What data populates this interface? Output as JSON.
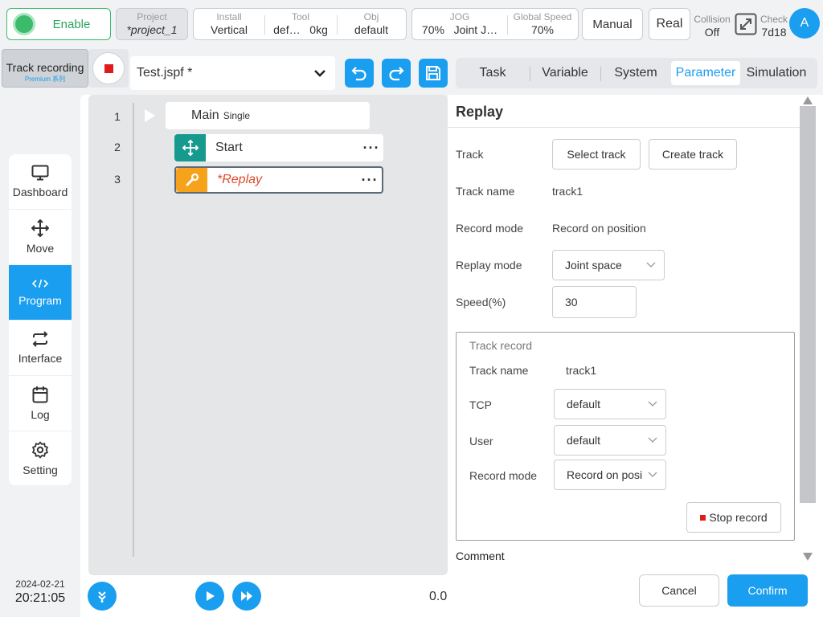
{
  "topbar": {
    "enable_label": "Enable",
    "project": {
      "label": "Project",
      "value": "*project_1"
    },
    "install": {
      "label": "Install",
      "value": "Vertical"
    },
    "tool": {
      "label": "Tool",
      "value_name": "def…",
      "value_weight": "0kg"
    },
    "obj": {
      "label": "Obj",
      "value": "default"
    },
    "jog": {
      "label": "JOG",
      "value_pct": "70%",
      "value_mode": "Joint J…"
    },
    "global_speed": {
      "label": "Global Speed",
      "value": "70%"
    },
    "mode_label": "Manual",
    "real_label": "Real",
    "collision": {
      "label": "Collision",
      "value": "Off"
    },
    "check": {
      "label": "Check",
      "value": "7d18"
    },
    "avatar_letter": "A"
  },
  "track_recording": {
    "label": "Track recording",
    "sub": "Premium 系列"
  },
  "file_select": {
    "value": "Test.jspf *"
  },
  "tabs": [
    {
      "label": "Task"
    },
    {
      "label": "Variable"
    },
    {
      "label": "System"
    },
    {
      "label": "Parameter"
    },
    {
      "label": "Simulation"
    }
  ],
  "sidebar": {
    "items": [
      {
        "label": "Dashboard",
        "icon": "monitor-icon"
      },
      {
        "label": "Move",
        "icon": "move-arrows-icon"
      },
      {
        "label": "Program",
        "icon": "code-icon"
      },
      {
        "label": "Interface",
        "icon": "swap-icon"
      },
      {
        "label": "Log",
        "icon": "calendar-icon"
      },
      {
        "label": "Setting",
        "icon": "gear-icon"
      }
    ],
    "active": "Program"
  },
  "datetime": {
    "date": "2024-02-21",
    "time": "20:21:05"
  },
  "program": {
    "line_numbers": [
      "1",
      "2",
      "3"
    ],
    "main": {
      "label": "Main",
      "tag": "Single"
    },
    "nodes": [
      {
        "label": "Start",
        "icon": "move-arrows-icon",
        "color": "#169a8e"
      },
      {
        "label": "*Replay",
        "icon": "wrench-icon",
        "color": "#f7a21b"
      }
    ],
    "speed_value": "0.0"
  },
  "replay": {
    "title": "Replay",
    "track_label": "Track",
    "select_track": "Select track",
    "create_track": "Create track",
    "track_name_label": "Track name",
    "track_name": "track1",
    "record_mode_label": "Record mode",
    "record_mode": "Record on position",
    "replay_mode_label": "Replay mode",
    "replay_mode": "Joint space",
    "speed_label": "Speed(%)",
    "speed": "30",
    "record_box": {
      "title": "Track record",
      "track_name_label": "Track name",
      "track_name": "track1",
      "tcp_label": "TCP",
      "tcp": "default",
      "user_label": "User",
      "user": "default",
      "record_mode_label": "Record mode",
      "record_mode": "Record on posi",
      "stop_record": "Stop record"
    },
    "comment_label": "Comment",
    "cancel": "Cancel",
    "confirm": "Confirm"
  },
  "colors": {
    "accent": "#1a9ef0",
    "enable_green": "#3bbb6b",
    "stop_red": "#e01b1b",
    "replay_orange": "#f7a21b",
    "start_teal": "#169a8e"
  }
}
